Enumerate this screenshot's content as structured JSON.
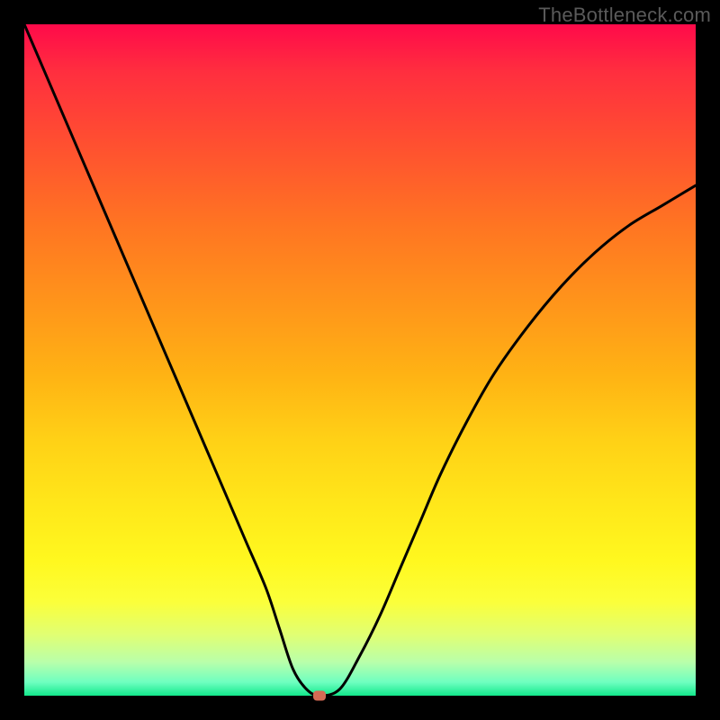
{
  "watermark": "TheBottleneck.com",
  "chart_data": {
    "type": "line",
    "title": "",
    "xlabel": "",
    "ylabel": "",
    "xlim": [
      0,
      100
    ],
    "ylim": [
      0,
      100
    ],
    "grid": false,
    "series": [
      {
        "name": "bottleneck-curve",
        "x": [
          0,
          3,
          6,
          9,
          12,
          15,
          18,
          21,
          24,
          27,
          30,
          33,
          36,
          38,
          40,
          42,
          44,
          47,
          50,
          53,
          56,
          59,
          62,
          66,
          70,
          75,
          80,
          85,
          90,
          95,
          100
        ],
        "values": [
          100,
          93,
          86,
          79,
          72,
          65,
          58,
          51,
          44,
          37,
          30,
          23,
          16,
          10,
          4,
          1,
          0,
          1,
          6,
          12,
          19,
          26,
          33,
          41,
          48,
          55,
          61,
          66,
          70,
          73,
          76
        ]
      }
    ],
    "marker": {
      "x": 44,
      "y": 0,
      "color": "#d46a54"
    },
    "colors": {
      "top": "#ff0a4a",
      "mid": "#ffe81a",
      "bottom": "#12e88b",
      "curve": "#000000",
      "frame": "#000000"
    }
  }
}
